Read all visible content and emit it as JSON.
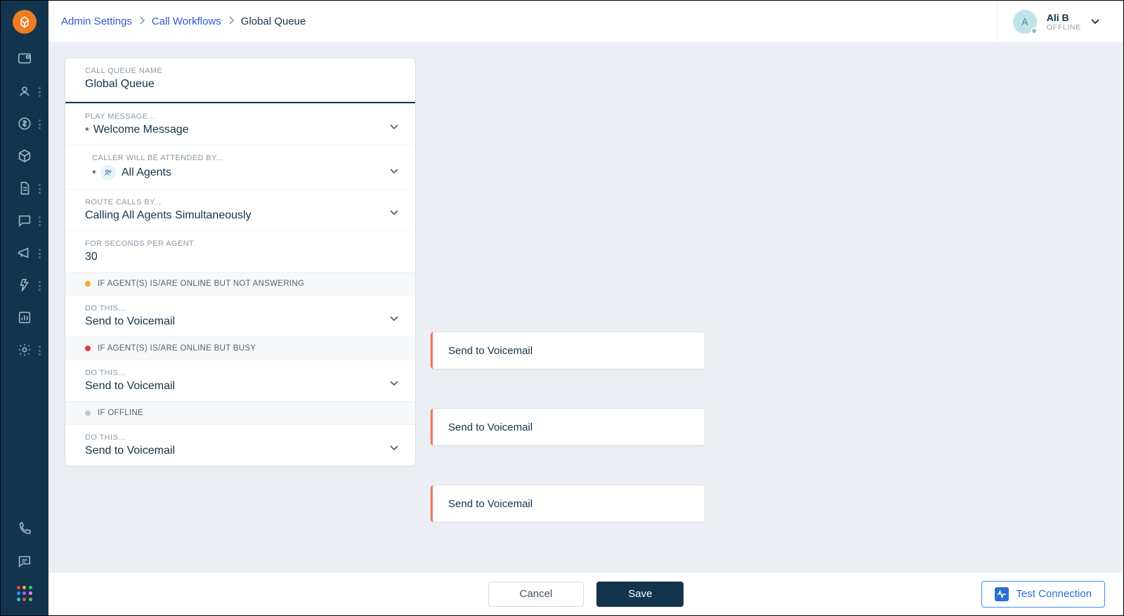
{
  "breadcrumbs": {
    "admin": "Admin Settings",
    "workflows": "Call Workflows",
    "current": "Global Queue"
  },
  "user": {
    "initial": "A",
    "name": "Ali B",
    "status": "OFFLINE"
  },
  "form": {
    "queue_name_label": "CALL QUEUE NAME",
    "queue_name_value": "Global Queue",
    "play_message_label": "PLAY MESSAGE...",
    "play_message_value": "Welcome Message",
    "attended_by_label": "CALLER WILL BE ATTENDED BY...",
    "attended_by_value": "All Agents",
    "route_by_label": "ROUTE CALLS BY...",
    "route_by_value": "Calling All Agents Simultaneously",
    "seconds_label": "FOR SECONDS PER AGENT",
    "seconds_value": "30",
    "status1": "IF AGENT(S) IS/ARE ONLINE BUT NOT ANSWERING",
    "do_this": "DO THIS...",
    "voicemail": "Send to Voicemail",
    "status2": "IF AGENT(S) IS/ARE ONLINE BUT BUSY",
    "status3": "IF OFFLINE"
  },
  "branches": {
    "b1": "Send to Voicemail",
    "b2": "Send to Voicemail",
    "b3": "Send to Voicemail"
  },
  "footer": {
    "cancel": "Cancel",
    "save": "Save",
    "test": "Test Connection"
  }
}
